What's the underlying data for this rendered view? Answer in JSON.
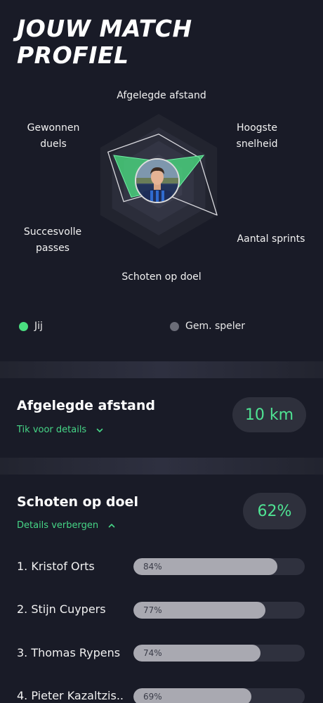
{
  "title": {
    "line1": "JOUW MATCH",
    "line2": "PROFIEL"
  },
  "radar": {
    "axes": [
      "Afgelegde afstand",
      "Hoogste snelheid",
      "Aantal sprints",
      "Schoten op doel",
      "Succesvolle passes",
      "Gewonnen duels"
    ],
    "labels": {
      "distance": "Afgelegde afstand",
      "speed_1": "Hoogste",
      "speed_2": "snelheid",
      "sprints": "Aantal sprints",
      "shots": "Schoten op doel",
      "passes_1": "Succesvolle",
      "passes_2": "passes",
      "duels_1": "Gewonnen",
      "duels_2": "duels"
    },
    "player_color": "#4ade80",
    "average_color": "#6b6d78",
    "player_values": [
      0.3,
      0.77,
      0.29,
      0.14,
      0.47,
      0.77
    ],
    "average_values": [
      0.7,
      0.7,
      1.0,
      0.15,
      0.6,
      0.87
    ]
  },
  "legend": {
    "player": "Jij",
    "average": "Gem. speler"
  },
  "distance_card": {
    "title": "Afgelegde afstand",
    "link": "Tik voor details",
    "value": "10 km"
  },
  "shots_card": {
    "title": "Schoten op doel",
    "link": "Details verbergen",
    "value": "62%",
    "ranking": [
      {
        "name": "1. Kristof Orts",
        "pct_label": "84%",
        "pct": 84
      },
      {
        "name": "2. Stijn Cuypers",
        "pct_label": "77%",
        "pct": 77
      },
      {
        "name": "3. Thomas Rypens",
        "pct_label": "74%",
        "pct": 74
      },
      {
        "name": "4. Pieter Kazaltzis..",
        "pct_label": "69%",
        "pct": 69
      }
    ]
  }
}
